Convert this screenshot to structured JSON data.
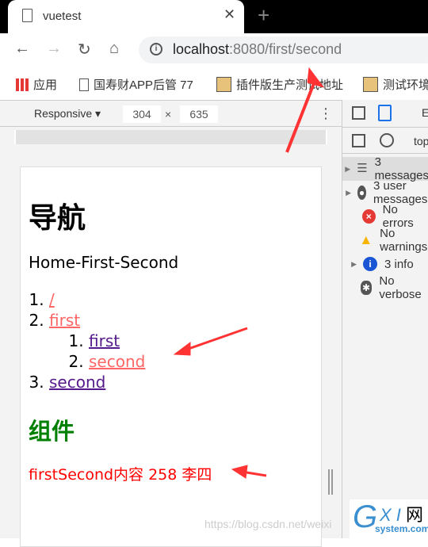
{
  "browser": {
    "tab_title": "vuetest",
    "url_host": "localhost",
    "url_path": ":8080/first/second",
    "bookmarks": [
      "应用",
      "国寿财APP后管 77",
      "插件版生产测试地址",
      "测试环境"
    ]
  },
  "devtools": {
    "device": "Responsive",
    "width": "304",
    "height": "635",
    "top_label": "top",
    "tab_partial": "E",
    "console": [
      {
        "label": "3 messages",
        "icon": "list-icon",
        "expand": true,
        "color": "#555"
      },
      {
        "label": "3 user messages",
        "icon": "user-icon",
        "expand": true,
        "color": "#555"
      },
      {
        "label": "No errors",
        "icon": "error-icon",
        "expand": false,
        "color": "#e53935"
      },
      {
        "label": "No warnings",
        "icon": "warning-icon",
        "expand": false,
        "color": "#f4b400"
      },
      {
        "label": "3 info",
        "icon": "info-icon",
        "expand": true,
        "color": "#1a55d6"
      },
      {
        "label": "No verbose",
        "icon": "bug-icon",
        "expand": false,
        "color": "#555"
      }
    ]
  },
  "page": {
    "heading": "导航",
    "breadcrumb": "Home-First-Second",
    "links": [
      {
        "text": "/",
        "active": true
      },
      {
        "text": "first",
        "active": true,
        "children": [
          {
            "text": "first",
            "active": false
          },
          {
            "text": "second",
            "active": true
          }
        ]
      },
      {
        "text": "second",
        "active": false
      }
    ],
    "component_heading": "组件",
    "component_text": "firstSecond内容 258 李四"
  },
  "watermark": "https://blog.csdn.net/weixi",
  "logo_text": "GXI网 system.com"
}
